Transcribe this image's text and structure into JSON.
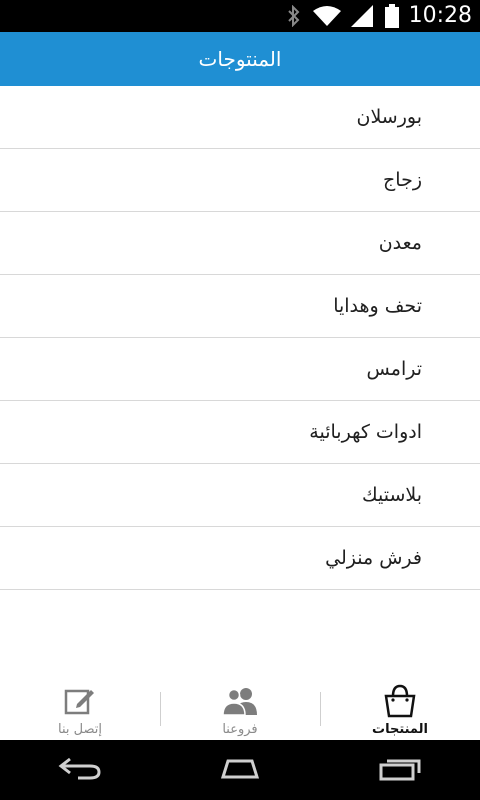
{
  "status_bar": {
    "time": "10:28"
  },
  "header": {
    "title": "المنتوجات"
  },
  "products": [
    {
      "label": "بورسلان"
    },
    {
      "label": "زجاج"
    },
    {
      "label": "معدن"
    },
    {
      "label": "تحف وهدايا"
    },
    {
      "label": "ترامس"
    },
    {
      "label": "ادوات كهربائية"
    },
    {
      "label": "بلاستيك"
    },
    {
      "label": "فرش منزلي"
    }
  ],
  "tabs": {
    "contact": {
      "label": "إتصل بنا",
      "icon": "edit-icon"
    },
    "branches": {
      "label": "فروعنا",
      "icon": "people-icon"
    },
    "products": {
      "label": "المنتجات",
      "icon": "shopping-bag-icon"
    }
  },
  "colors": {
    "accent": "#1f8fd3",
    "divider": "#d8d8d8"
  }
}
